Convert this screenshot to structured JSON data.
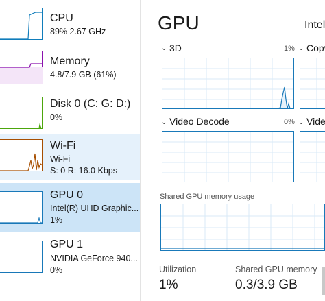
{
  "sidebar": {
    "items": [
      {
        "title": "CPU",
        "line1": "89%  2.67 GHz",
        "line2": "",
        "color": "#117dbb",
        "usage": 0.95
      },
      {
        "title": "Memory",
        "line1": "4.8/7.9 GB (61%)",
        "line2": "",
        "color": "#8b12ae",
        "usage": 0.61
      },
      {
        "title": "Disk 0 (C: G: D:)",
        "line1": "0%",
        "line2": "",
        "color": "#4da60c",
        "usage": 0.0
      },
      {
        "title": "Wi-Fi",
        "line1": "Wi-Fi",
        "line2": "S: 0  R: 16.0 Kbps",
        "color": "#a74f01",
        "usage": 0.3
      },
      {
        "title": "GPU 0",
        "line1": "Intel(R) UHD Graphic...",
        "line2": "1%",
        "color": "#1979b9",
        "usage": 0.01
      },
      {
        "title": "GPU 1",
        "line1": "NVIDIA GeForce 940...",
        "line2": "0%",
        "color": "#1979b9",
        "usage": 0.0
      }
    ]
  },
  "main": {
    "heading": "GPU",
    "adapter_name": "Intel",
    "engines": [
      {
        "name": "3D",
        "percent": "1%"
      },
      {
        "name": "Copy",
        "percent": ""
      },
      {
        "name": "Video Decode",
        "percent": "0%"
      },
      {
        "name": "Video",
        "percent": ""
      }
    ],
    "shared_memory_label": "Shared GPU memory usage",
    "stats": [
      {
        "label": "Utilization",
        "value": "1%"
      },
      {
        "label": "Shared GPU memory",
        "value": "0.3/3.9 GB"
      }
    ]
  },
  "colors": {
    "gpu": "#1979b9",
    "grid": "#d9eaf7",
    "selected": "#cce4f7",
    "hover": "#e5f1fb"
  }
}
